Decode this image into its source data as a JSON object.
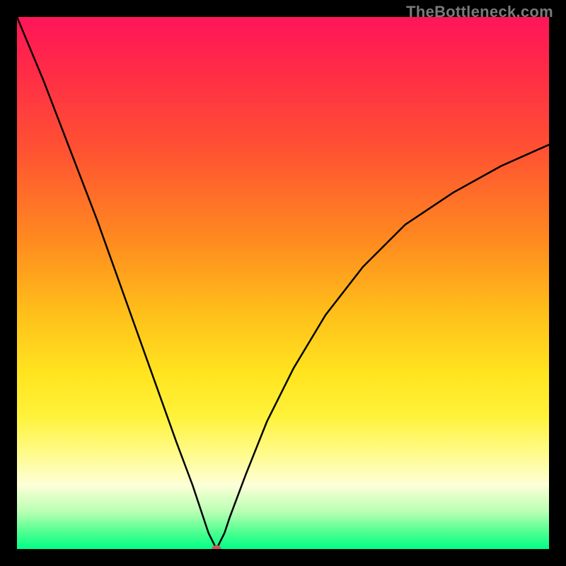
{
  "watermark": "TheBottleneck.com",
  "colors": {
    "frame_bg": "#000000",
    "curve_stroke": "#000000",
    "marker_fill": "#c75a56",
    "gradient_stops": [
      {
        "pos": 0.0,
        "hex": "#ff1559"
      },
      {
        "pos": 0.1,
        "hex": "#ff2b47"
      },
      {
        "pos": 0.25,
        "hex": "#ff5232"
      },
      {
        "pos": 0.42,
        "hex": "#ff8a1f"
      },
      {
        "pos": 0.55,
        "hex": "#ffbd1a"
      },
      {
        "pos": 0.67,
        "hex": "#ffe41f"
      },
      {
        "pos": 0.75,
        "hex": "#fff23a"
      },
      {
        "pos": 0.82,
        "hex": "#fffb8a"
      },
      {
        "pos": 0.88,
        "hex": "#fdffd8"
      },
      {
        "pos": 0.93,
        "hex": "#b9ffb2"
      },
      {
        "pos": 0.97,
        "hex": "#4aff8f"
      },
      {
        "pos": 1.0,
        "hex": "#00ff88"
      }
    ]
  },
  "chart_data": {
    "type": "line",
    "title": "",
    "xlabel": "",
    "ylabel": "",
    "xlim": [
      0,
      100
    ],
    "ylim": [
      0,
      100
    ],
    "minimum": {
      "x": 37.5,
      "y": 0
    },
    "series": [
      {
        "name": "curve",
        "x": [
          0,
          5,
          10,
          15,
          20,
          25,
          30,
          33,
          35,
          36,
          37.5,
          39,
          40,
          43,
          47,
          52,
          58,
          65,
          73,
          82,
          91,
          100
        ],
        "y": [
          100,
          88,
          75,
          62,
          48,
          34,
          20,
          12,
          6,
          3,
          0,
          3,
          6,
          14,
          24,
          34,
          44,
          53,
          61,
          67,
          72,
          76
        ]
      }
    ],
    "annotations": [
      {
        "type": "dot",
        "x": 37.5,
        "y": 0,
        "color": "#c75a56"
      }
    ]
  }
}
